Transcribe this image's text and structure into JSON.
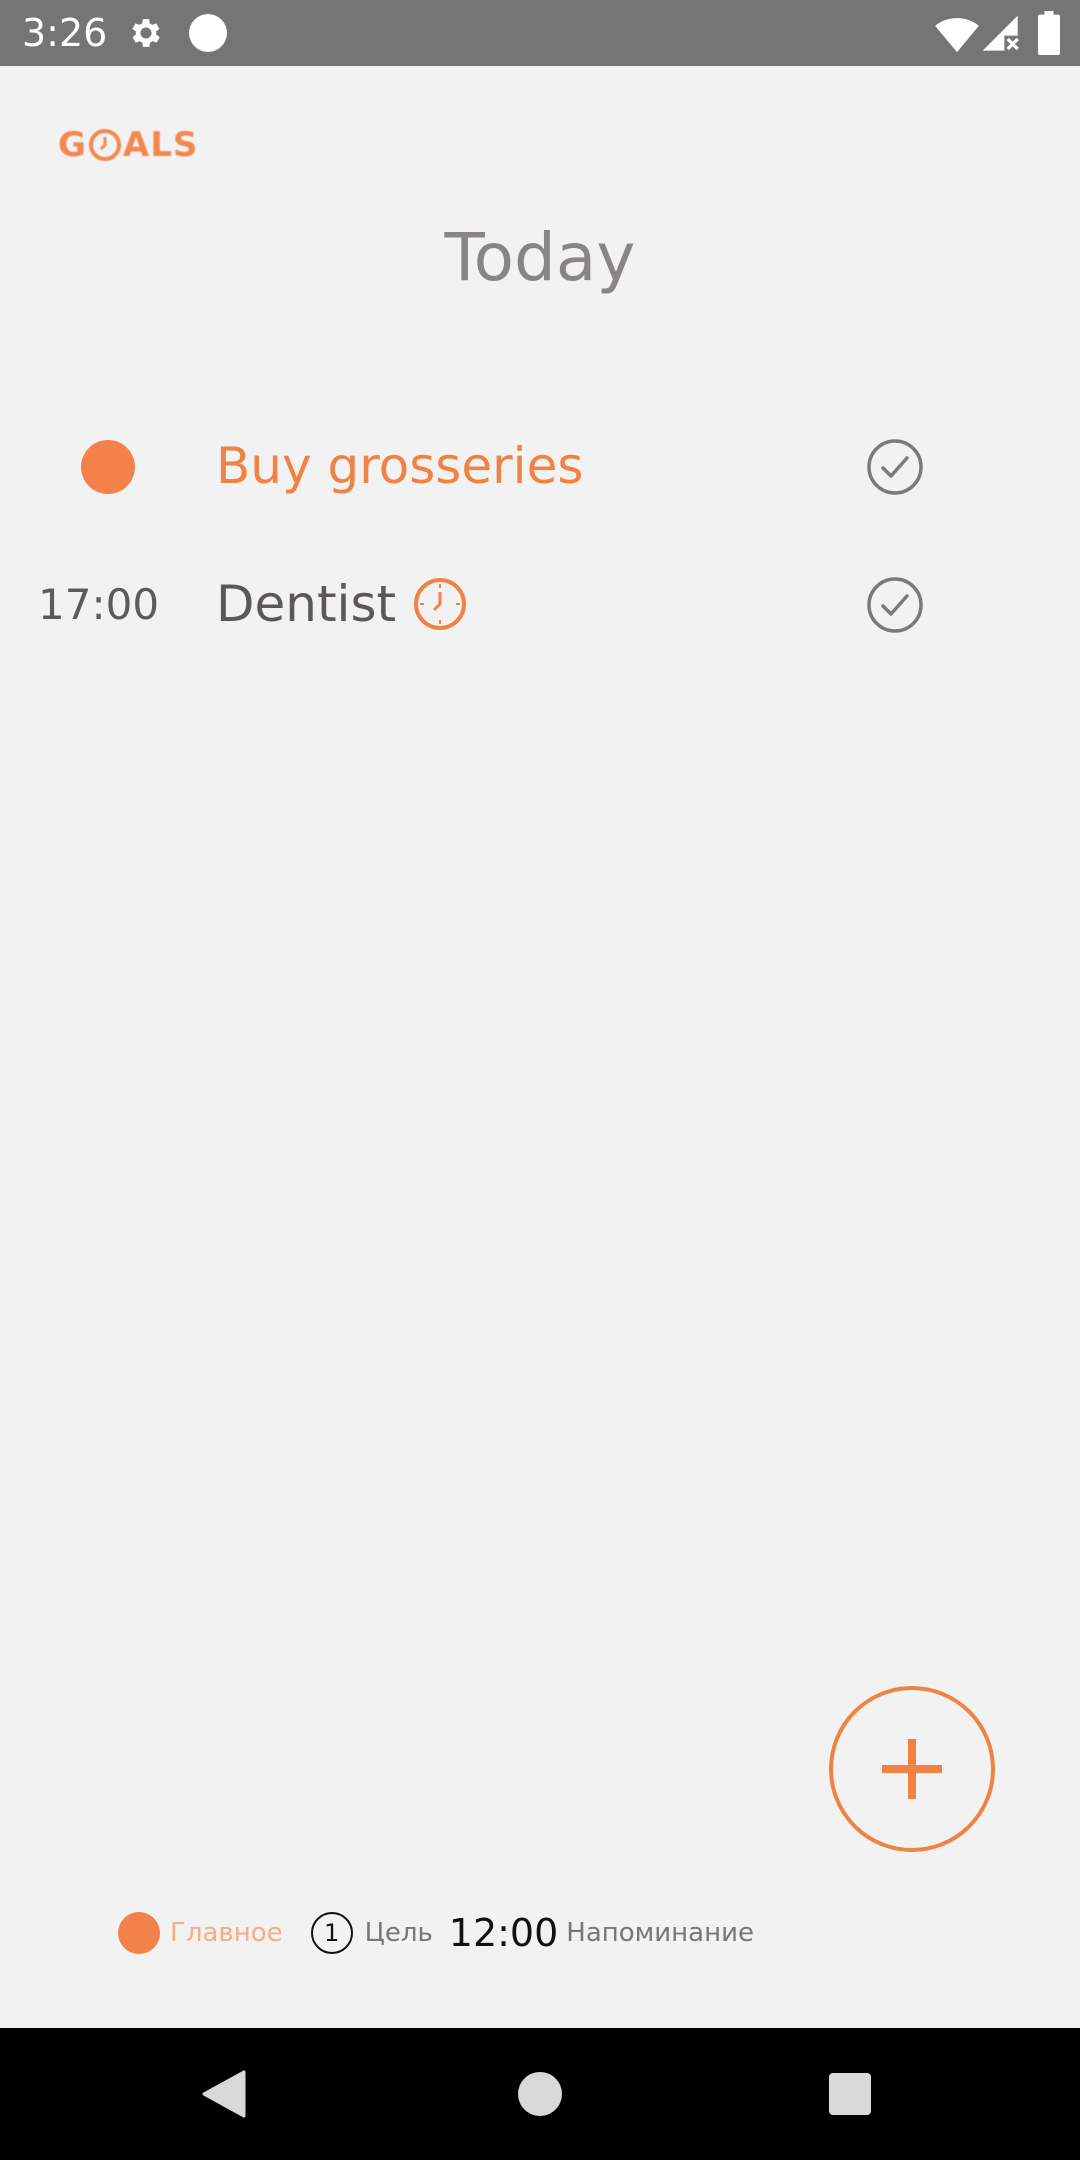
{
  "status_bar": {
    "time": "3:26",
    "icons": [
      "gear-icon",
      "circle-notification-icon",
      "wifi-icon",
      "signal-no-data-icon",
      "battery-icon"
    ]
  },
  "app": {
    "logo_text_left": "G",
    "logo_text_right": "ALS",
    "accent_color": "#f08243"
  },
  "page": {
    "title": "Today"
  },
  "tasks": [
    {
      "marker": "important-dot",
      "title": "Buy grosseries",
      "time": "",
      "reminder": false,
      "style": "important"
    },
    {
      "marker": "time",
      "title": "Dentist",
      "time": "17:00",
      "reminder": true,
      "style": "normal"
    }
  ],
  "fab": {
    "icon": "plus-icon"
  },
  "legend": {
    "important_label": "Главное",
    "goal_number": "1",
    "goal_label": "Цель",
    "reminder_time": "12:00",
    "reminder_label": "Напоминание"
  },
  "nav_bar": {
    "icons": [
      "back-icon",
      "home-icon",
      "recents-icon"
    ]
  }
}
